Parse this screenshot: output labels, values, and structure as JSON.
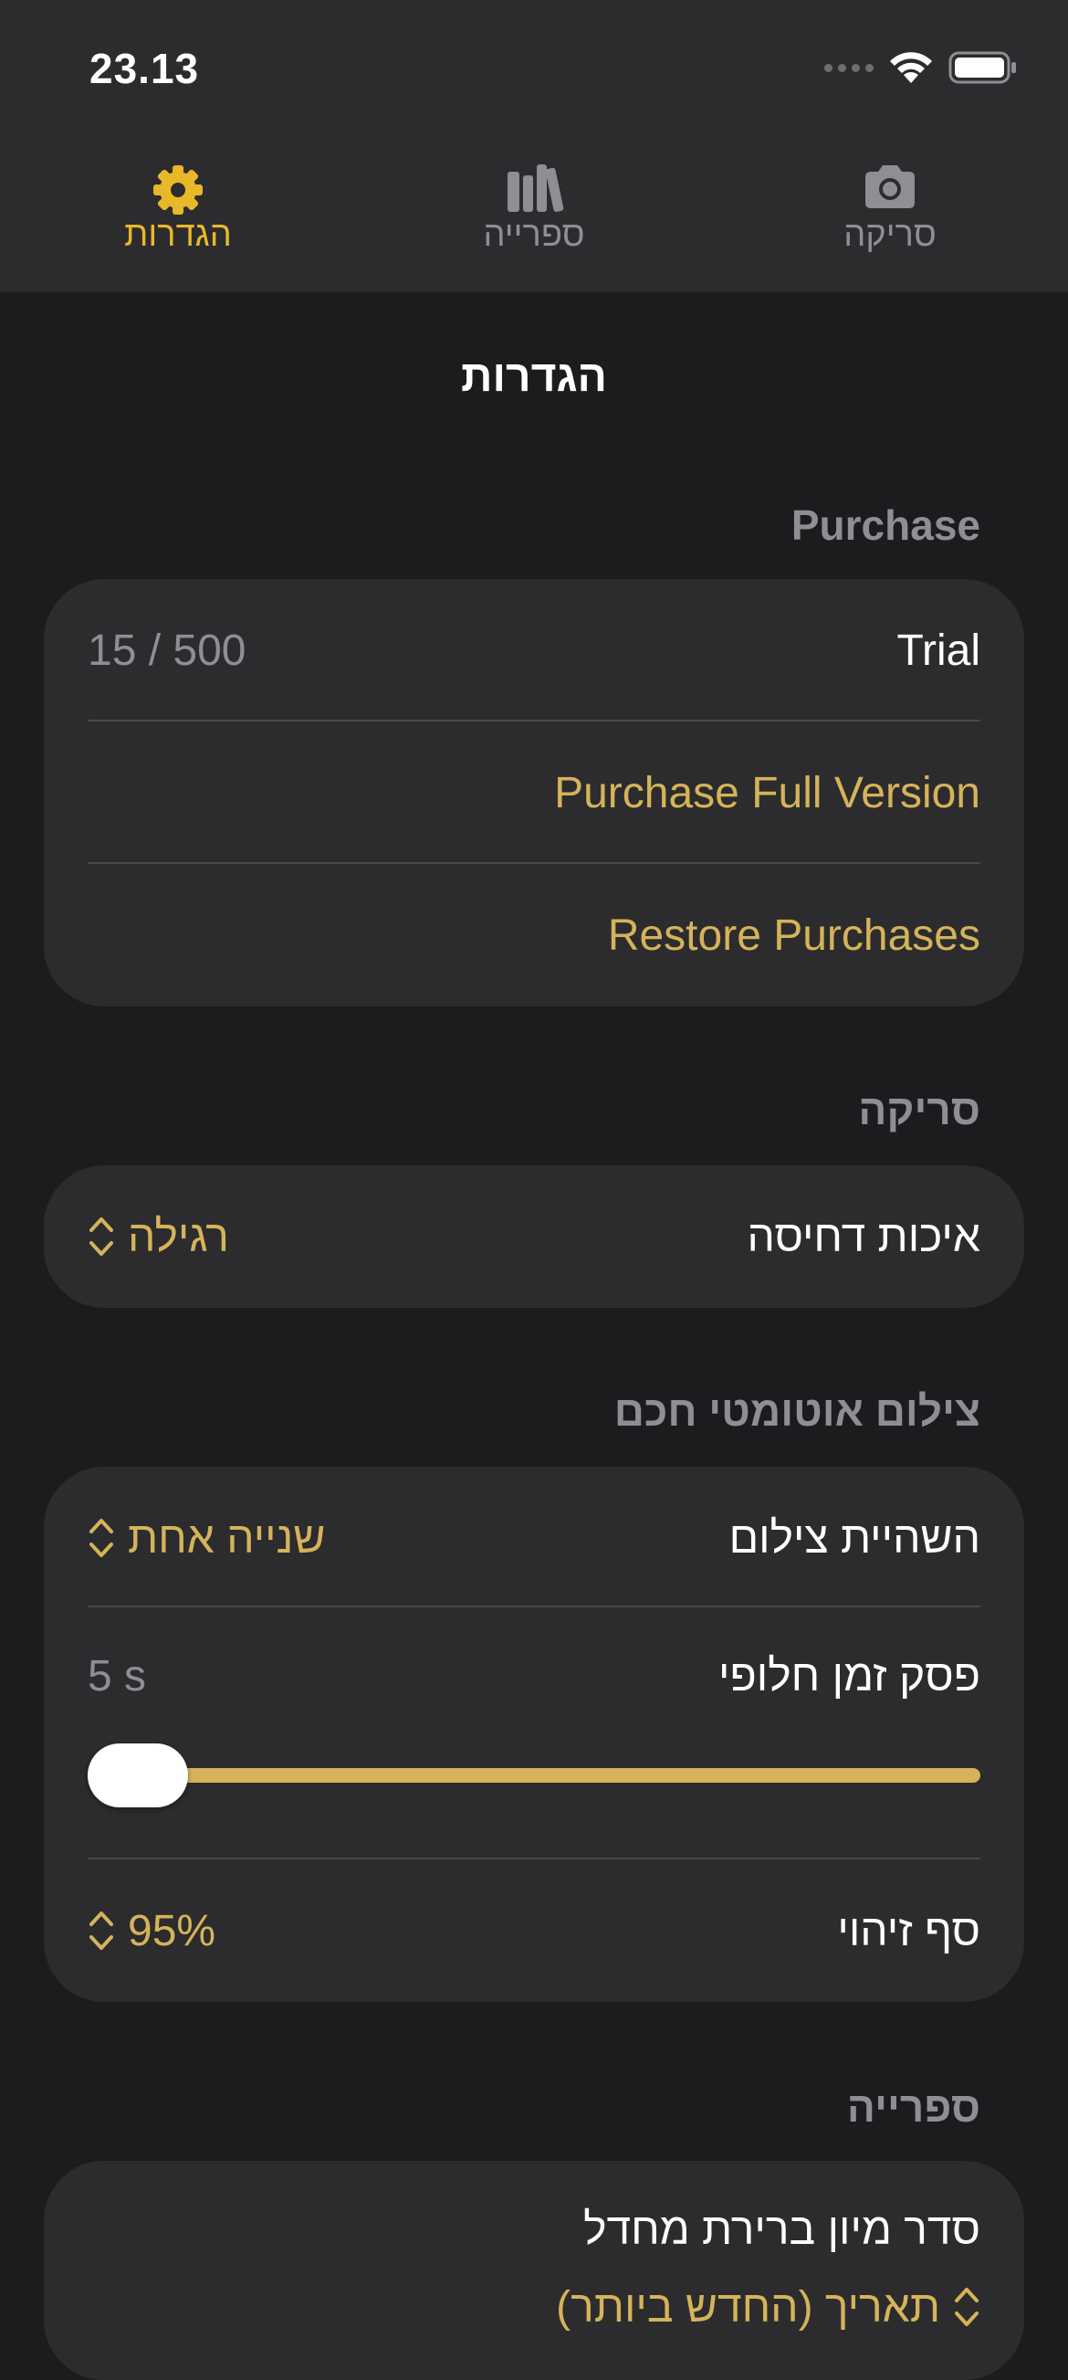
{
  "status_bar": {
    "time": "23.13"
  },
  "tabs": [
    {
      "label": "סריקה",
      "icon": "camera-icon"
    },
    {
      "label": "ספרייה",
      "icon": "library-icon"
    },
    {
      "label": "הגדרות",
      "icon": "gear-icon",
      "active": true
    }
  ],
  "page_title": "הגדרות",
  "purchase": {
    "header": "Purchase",
    "trial_label": "Trial",
    "trial_value": "15 / 500",
    "purchase_full": "Purchase Full Version",
    "restore": "Restore Purchases"
  },
  "scan": {
    "header": "סריקה",
    "compression_label": "איכות דחיסה",
    "compression_value": "רגילה"
  },
  "smart_capture": {
    "header": "צילום אוטומטי חכם",
    "delay_label": "השהיית צילום",
    "delay_value": "שנייה אחת",
    "timeout_label": "פסק זמן חלופי",
    "timeout_value": "5 s",
    "timeout_slider_fraction": 0,
    "threshold_label": "סף זיהוי",
    "threshold_value": "95%"
  },
  "library": {
    "header": "ספרייה",
    "sort_label": "סדר מיון ברירת מחדל",
    "sort_value": "תאריך (החדש ביותר)"
  },
  "colors": {
    "accent": "#e9b829",
    "picker": "#d5b35a",
    "background": "#1c1c1e",
    "card": "#2c2c2e"
  }
}
